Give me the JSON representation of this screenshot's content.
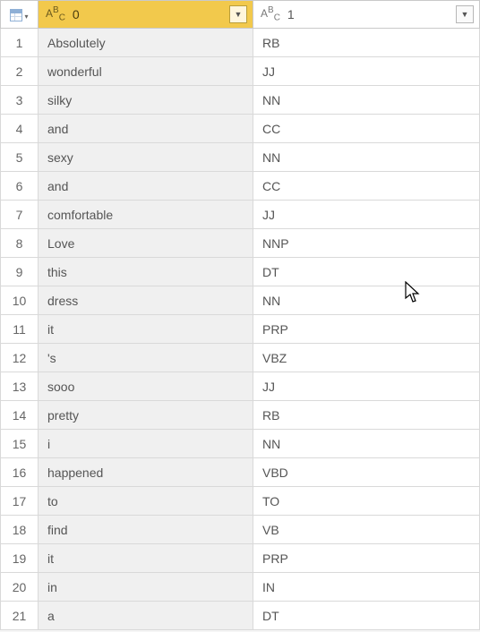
{
  "columns": {
    "type_prefix": "A",
    "type_super": "B",
    "type_sub": "C",
    "col0_name": "0",
    "col1_name": "1"
  },
  "rows": [
    {
      "n": "1",
      "c0": "Absolutely",
      "c1": "RB"
    },
    {
      "n": "2",
      "c0": "wonderful",
      "c1": "JJ"
    },
    {
      "n": "3",
      "c0": "silky",
      "c1": "NN"
    },
    {
      "n": "4",
      "c0": "and",
      "c1": "CC"
    },
    {
      "n": "5",
      "c0": "sexy",
      "c1": "NN"
    },
    {
      "n": "6",
      "c0": "and",
      "c1": "CC"
    },
    {
      "n": "7",
      "c0": "comfortable",
      "c1": "JJ"
    },
    {
      "n": "8",
      "c0": "Love",
      "c1": "NNP"
    },
    {
      "n": "9",
      "c0": "this",
      "c1": "DT"
    },
    {
      "n": "10",
      "c0": "dress",
      "c1": "NN"
    },
    {
      "n": "11",
      "c0": "it",
      "c1": "PRP"
    },
    {
      "n": "12",
      "c0": "'s",
      "c1": "VBZ"
    },
    {
      "n": "13",
      "c0": "sooo",
      "c1": "JJ"
    },
    {
      "n": "14",
      "c0": "pretty",
      "c1": "RB"
    },
    {
      "n": "15",
      "c0": "i",
      "c1": "NN"
    },
    {
      "n": "16",
      "c0": "happened",
      "c1": "VBD"
    },
    {
      "n": "17",
      "c0": "to",
      "c1": "TO"
    },
    {
      "n": "18",
      "c0": "find",
      "c1": "VB"
    },
    {
      "n": "19",
      "c0": "it",
      "c1": "PRP"
    },
    {
      "n": "20",
      "c0": "in",
      "c1": "IN"
    },
    {
      "n": "21",
      "c0": "a",
      "c1": "DT"
    }
  ]
}
